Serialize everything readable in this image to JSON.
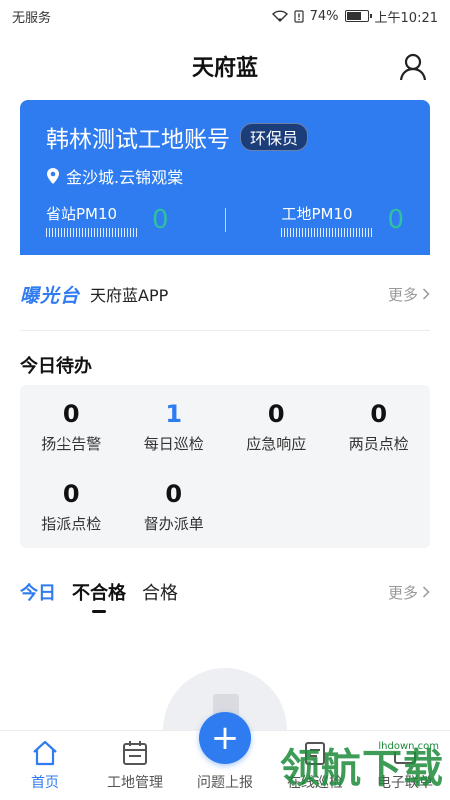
{
  "status_bar": {
    "carrier": "无服务",
    "battery": "74%",
    "time": "上午10:21",
    "battery_level": 0.74
  },
  "header": {
    "title": "天府蓝"
  },
  "site_card": {
    "title": "韩林测试工地账号",
    "role": "环保员",
    "location": "金沙城.云锦观棠",
    "provincial_pm_label": "省站PM10",
    "provincial_pm_value": "0",
    "site_pm_label": "工地PM10",
    "site_pm_value": "0"
  },
  "notice": {
    "logo_text": "曝光台",
    "text": "天府蓝APP",
    "more_label": "更多"
  },
  "todo": {
    "title": "今日待办",
    "items": [
      {
        "count": "0",
        "label": "扬尘告警"
      },
      {
        "count": "1",
        "label": "每日巡检"
      },
      {
        "count": "0",
        "label": "应急响应"
      },
      {
        "count": "0",
        "label": "两员点检"
      },
      {
        "count": "0",
        "label": "指派点检"
      },
      {
        "count": "0",
        "label": "督办派单"
      }
    ]
  },
  "today_tabs": {
    "today_label": "今日",
    "unqualified_label": "不合格",
    "qualified_label": "合格",
    "more_label": "更多"
  },
  "bottom_nav": {
    "items": [
      {
        "label": "首页"
      },
      {
        "label": "工地管理"
      },
      {
        "label": "问题上报"
      },
      {
        "label": "在线巡检"
      },
      {
        "label": "电子联单"
      }
    ],
    "fab_symbol": "+"
  },
  "watermark": {
    "text": "领航下载",
    "url": "lhdown.com"
  },
  "colors": {
    "primary": "#2f7cf0",
    "pm_value": "#2ec0a0",
    "badge_bg": "#1b3d7a",
    "watermark": "#1d8b3a"
  }
}
